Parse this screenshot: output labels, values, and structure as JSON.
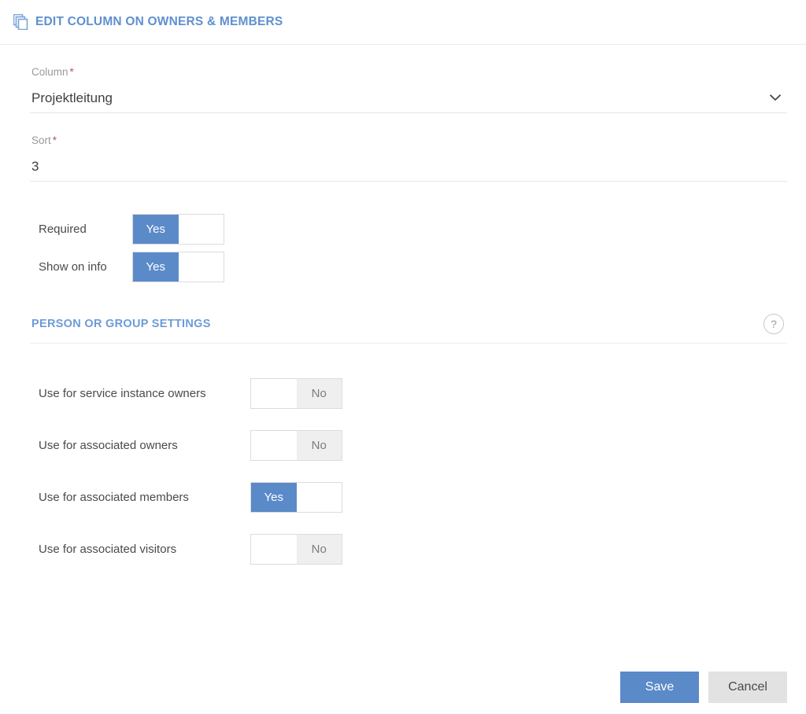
{
  "header": {
    "icon": "copy-stack-icon",
    "title": "EDIT COLUMN ON OWNERS & MEMBERS",
    "accent_color": "#5f90cf"
  },
  "form": {
    "required_marker": "*",
    "fields": [
      {
        "name": "column",
        "label": "Column",
        "required": true,
        "value": "Projektleitung",
        "control": "select",
        "icon": "chevron-down-icon"
      },
      {
        "name": "sort",
        "label": "Sort",
        "required": true,
        "value": "3",
        "control": "text"
      }
    ],
    "toggles": [
      {
        "name": "required",
        "label": "Required",
        "value": "Yes",
        "on": true
      },
      {
        "name": "show-on-info",
        "label": "Show on info",
        "value": "Yes",
        "on": true
      }
    ]
  },
  "section": {
    "title": "PERSON OR GROUP SETTINGS",
    "help_icon": "question-mark-icon",
    "help_glyph": "?",
    "accent_color": "#6d9bd6",
    "toggles": [
      {
        "name": "use-for-service-instance-owners",
        "label": "Use for service instance owners",
        "value": "No",
        "on": false
      },
      {
        "name": "use-for-associated-owners",
        "label": "Use for associated owners",
        "value": "No",
        "on": false
      },
      {
        "name": "use-for-associated-members",
        "label": "Use for associated members",
        "value": "Yes",
        "on": true
      },
      {
        "name": "use-for-associated-visitors",
        "label": "Use for associated visitors",
        "value": "No",
        "on": false
      }
    ]
  },
  "footer": {
    "save_label": "Save",
    "cancel_label": "Cancel",
    "save_color": "#5b8ac9",
    "cancel_color": "#e2e2e2"
  },
  "toggle_labels": {
    "yes": "Yes",
    "no": "No"
  }
}
